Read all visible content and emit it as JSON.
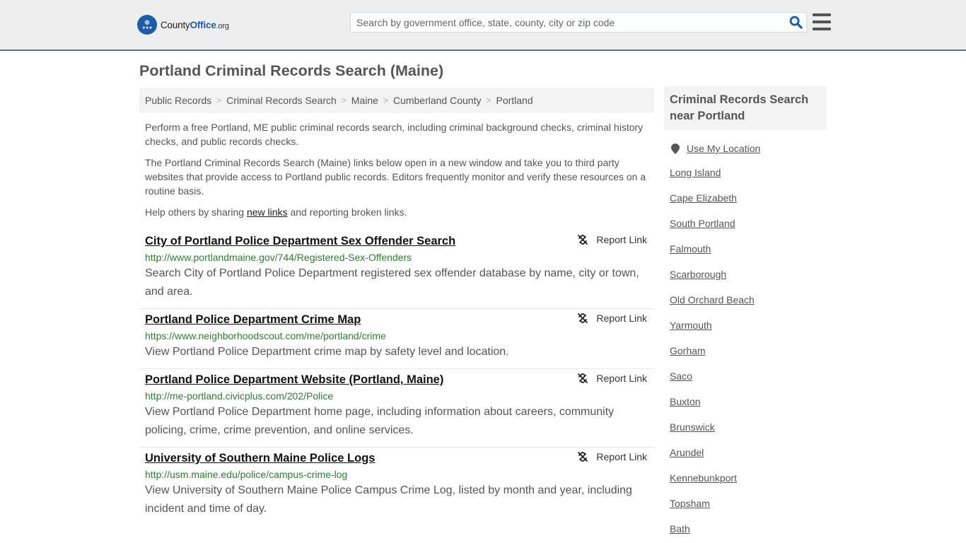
{
  "header": {
    "logo": {
      "name_part1": "County",
      "name_part2": "Office",
      "tld": ".org"
    },
    "search": {
      "placeholder": "Search by government office, state, county, city or zip code",
      "value": ""
    },
    "colors": {
      "brand": "#1b5da8",
      "accent_border": "#3b7bb0",
      "header_bg": "#eeeeee"
    }
  },
  "page": {
    "title": "Portland Criminal Records Search (Maine)",
    "breadcrumb": [
      "Public Records",
      "Criminal Records Search",
      "Maine",
      "Cumberland County",
      "Portland"
    ],
    "intro": {
      "p1": "Perform a free Portland, ME public criminal records search, including criminal background checks, criminal history checks, and public records checks.",
      "p2": "The Portland Criminal Records Search (Maine) links below open in a new window and take you to third party websites that provide access to Portland public records. Editors frequently monitor and verify these resources on a routine basis.",
      "p3_before": "Help others by sharing ",
      "p3_link": "new links",
      "p3_after": " and reporting broken links."
    }
  },
  "results": [
    {
      "title": "City of Portland Police Department Sex Offender Search",
      "url": "http://www.portlandmaine.gov/744/Registered-Sex-Offenders",
      "description": "Search City of Portland Police Department registered sex offender database by name, city or town, and area.",
      "report_label": "Report Link"
    },
    {
      "title": "Portland Police Department Crime Map",
      "url": "https://www.neighborhoodscout.com/me/portland/crime",
      "description": "View Portland Police Department crime map by safety level and location.",
      "report_label": "Report Link"
    },
    {
      "title": "Portland Police Department Website (Portland, Maine)",
      "url": "http://me-portland.civicplus.com/202/Police",
      "description": "View Portland Police Department home page, including information about careers, community policing, crime, crime prevention, and online services.",
      "report_label": "Report Link"
    },
    {
      "title": "University of Southern Maine Police Logs",
      "url": "http://usm.maine.edu/police/campus-crime-log",
      "description": "View University of Southern Maine Police Campus Crime Log, listed by month and year, including incident and time of day.",
      "report_label": "Report Link"
    }
  ],
  "sidebar": {
    "heading": "Criminal Records Search near Portland",
    "use_location_label": "Use My Location",
    "nearby": [
      "Long Island",
      "Cape Elizabeth",
      "South Portland",
      "Falmouth",
      "Scarborough",
      "Old Orchard Beach",
      "Yarmouth",
      "Gorham",
      "Saco",
      "Buxton",
      "Brunswick",
      "Arundel",
      "Kennebunkport",
      "Topsham",
      "Bath"
    ]
  }
}
